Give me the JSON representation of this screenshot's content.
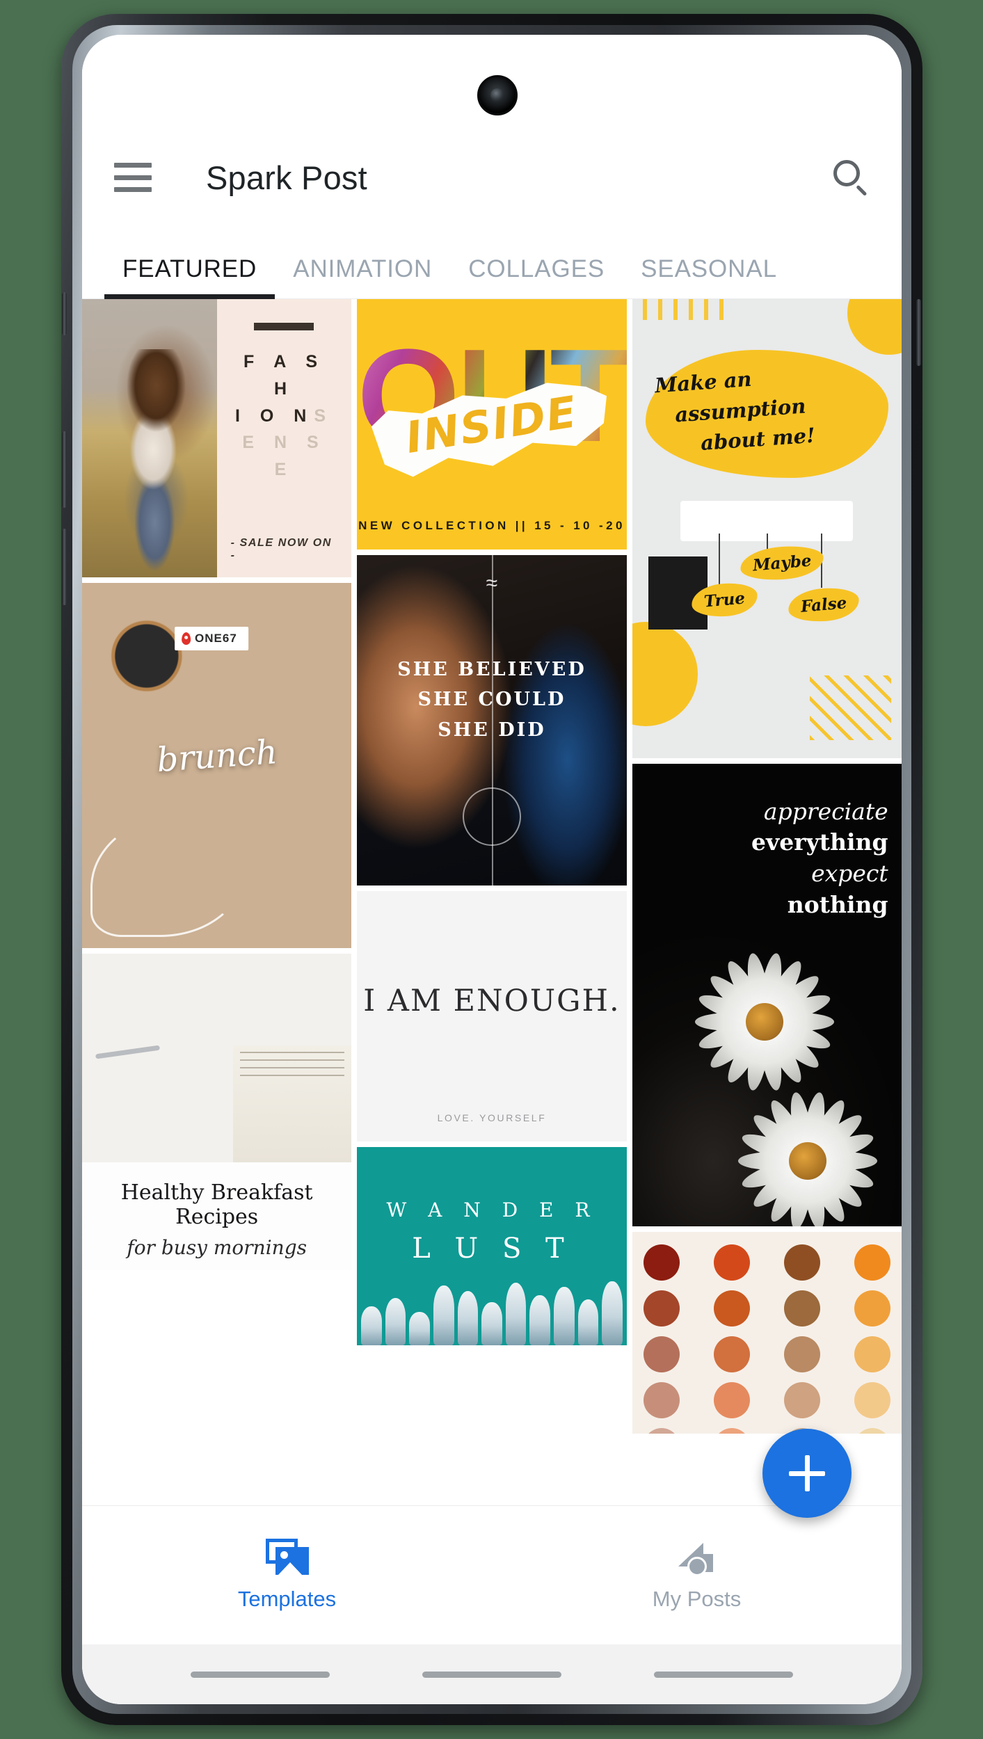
{
  "app": {
    "title": "Spark Post",
    "menu_icon": "hamburger-menu-icon",
    "search_icon": "search-icon"
  },
  "tabs": [
    {
      "label": "FEATURED",
      "active": true
    },
    {
      "label": "ANIMATION",
      "active": false
    },
    {
      "label": "COLLAGES",
      "active": false
    },
    {
      "label": "SEASONAL",
      "active": false
    }
  ],
  "templates": {
    "fashion": {
      "rule": "",
      "line1": "F A S H",
      "line2_dark": "I O N",
      "line2_light": "S",
      "line3": "E N S E",
      "sale": "- SALE NOW ON -"
    },
    "brunch": {
      "tag": "ONE67",
      "script": "brunch"
    },
    "healthy": {
      "title": "Healthy Breakfast Recipes",
      "subtitle": "for busy mornings"
    },
    "out": {
      "word": "OUT",
      "overlay": "INSIDE",
      "footer": "NEW COLLECTION  ||  15 - 10 -20"
    },
    "believed": {
      "wave": "≈",
      "line1": "SHE BELIEVED",
      "line2": "SHE COULD",
      "line3": "SHE DID"
    },
    "enough": {
      "headline": "I AM ENOUGH.",
      "footer": "LOVE. YOURSELF"
    },
    "wander": {
      "line1": "W A N D E R",
      "line2": "L U S T"
    },
    "assumption": {
      "line1": "Make an",
      "line2": "assumption",
      "line3": "about me!",
      "option_maybe": "Maybe",
      "option_true": "True",
      "option_false": "False"
    },
    "daisy": {
      "line1": "appreciate",
      "line2": "everything",
      "line3": "expect",
      "line4": "nothing"
    },
    "palette": {
      "rows": [
        [
          "#8c1d10",
          "#d4491a",
          "#8f4f23",
          "#f08a1e"
        ],
        [
          "#a4462a",
          "#c9591f",
          "#9c6a3c",
          "#f0a03a"
        ],
        [
          "#b4705a",
          "#d2703e",
          "#b98a63",
          "#f1b661"
        ],
        [
          "#c78f7a",
          "#e58a5e",
          "#cfa281",
          "#f3c98a"
        ],
        [
          "#d2a795",
          "#eda37c",
          "#cdb295",
          "#f0d6a5"
        ]
      ]
    }
  },
  "fab": {
    "label": "+",
    "icon": "plus-icon",
    "color": "#1c72e0"
  },
  "bottom_nav": [
    {
      "label": "Templates",
      "icon": "image-templates-icon",
      "active": true
    },
    {
      "label": "My Posts",
      "icon": "my-posts-icon",
      "active": false
    }
  ],
  "colors": {
    "accent_blue": "#1c72e0",
    "yellow": "#f7c324",
    "teal": "#0f9a94",
    "tab_inactive": "#9aa5b0"
  }
}
